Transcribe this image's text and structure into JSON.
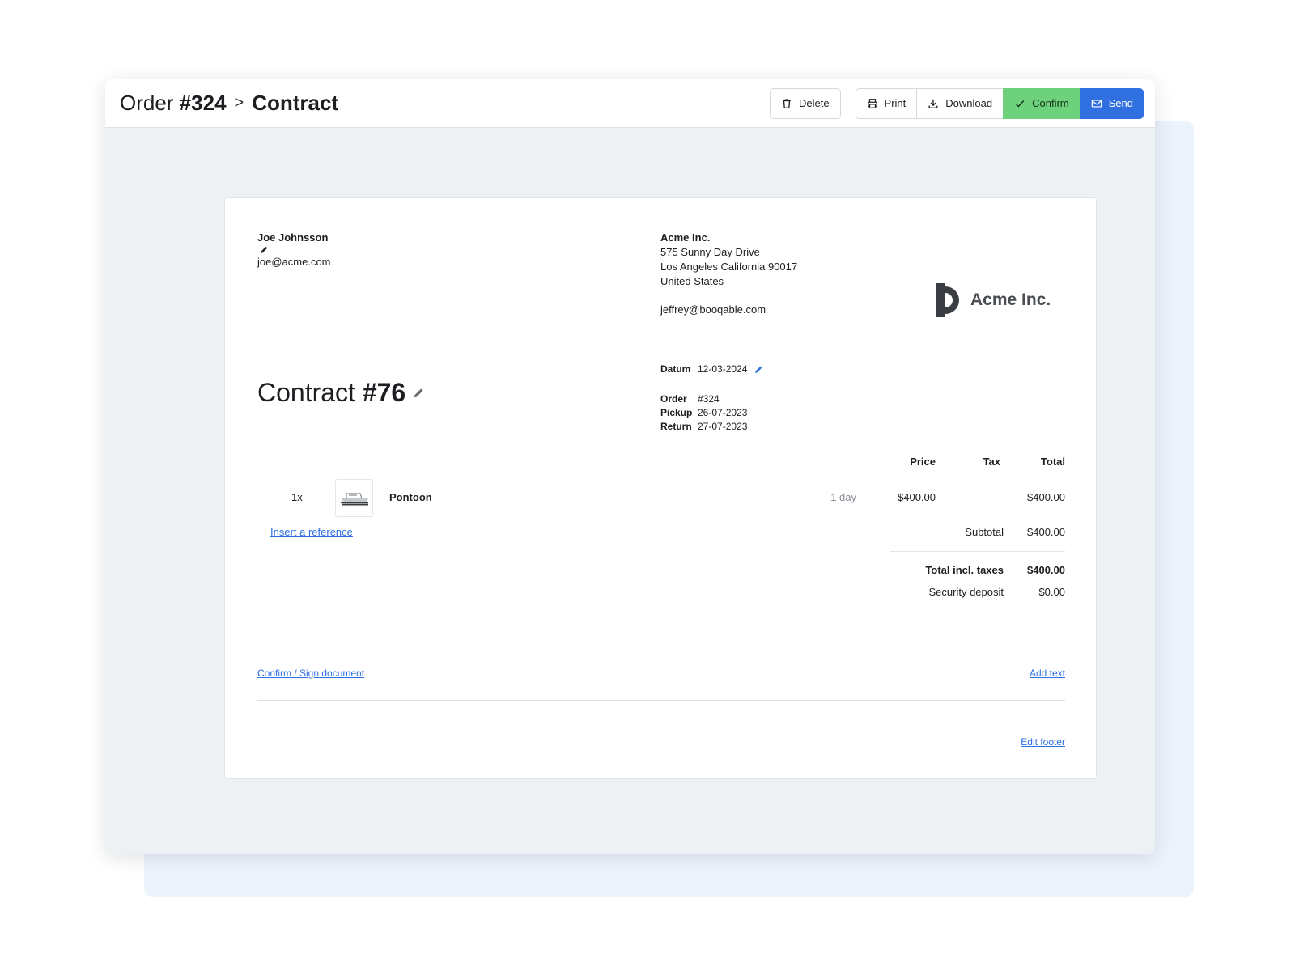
{
  "header": {
    "order_label": "Order",
    "order_number": "#324",
    "separator": ">",
    "current": "Contract"
  },
  "toolbar": {
    "delete": "Delete",
    "print": "Print",
    "download": "Download",
    "confirm": "Confirm",
    "send": "Send"
  },
  "customer": {
    "name": "Joe Johnsson",
    "email": "joe@acme.com"
  },
  "company": {
    "name": "Acme Inc.",
    "address_line1": "575 Sunny Day Drive",
    "address_line2": "Los Angeles California 90017",
    "country": "United States",
    "email": "jeffrey@booqable.com",
    "logo_text": "Acme Inc."
  },
  "document": {
    "title_prefix": "Contract",
    "number": "#76"
  },
  "meta": {
    "date_label": "Datum",
    "date_value": "12-03-2024",
    "order_label": "Order",
    "order_value": "#324",
    "pickup_label": "Pickup",
    "pickup_value": "26-07-2023",
    "return_label": "Return",
    "return_value": "27-07-2023"
  },
  "table": {
    "headers": {
      "price": "Price",
      "tax": "Tax",
      "total": "Total"
    },
    "items": [
      {
        "qty": "1x",
        "name": "Pontoon",
        "duration": "1 day",
        "price": "$400.00",
        "total": "$400.00"
      }
    ]
  },
  "links": {
    "insert_reference": "Insert a reference",
    "confirm_sign": "Confirm / Sign document",
    "add_text": "Add text",
    "edit_footer": "Edit footer"
  },
  "summary": {
    "subtotal_label": "Subtotal",
    "subtotal_value": "$400.00",
    "total_label": "Total incl. taxes",
    "total_value": "$400.00",
    "deposit_label": "Security deposit",
    "deposit_value": "$0.00"
  },
  "colors": {
    "confirm": "#6dd27b",
    "send": "#2f6fe0",
    "link": "#2f6fe0",
    "canvas": "#eef1f4"
  }
}
